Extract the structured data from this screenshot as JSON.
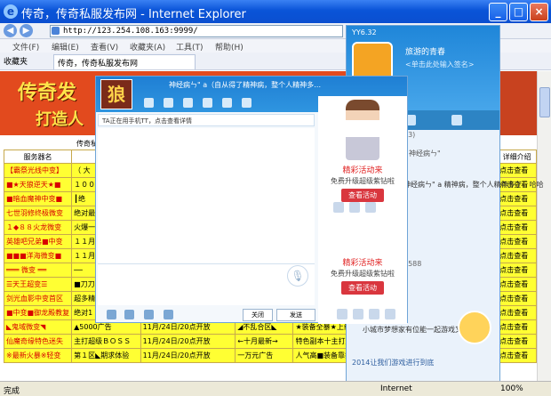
{
  "window": {
    "title": "传奇，传奇私服发布网 - Internet Explorer",
    "minimize": "_",
    "maximize": "□",
    "close": "×"
  },
  "address": {
    "url": "http://123.254.108.163:9999/"
  },
  "menu": [
    "文件(F)",
    "编辑(E)",
    "查看(V)",
    "收藏夹(A)",
    "工具(T)",
    "帮助(H)"
  ],
  "favorites": {
    "label": "收藏夹",
    "tab": "传奇，传奇私服发布网"
  },
  "banner": {
    "logo": "传奇发",
    "slogan": "打造人"
  },
  "list_title": "传奇私服",
  "table": {
    "headers": [
      "服务器名",
      "",
      "",
      "",
      "",
      "",
      "详细介绍"
    ],
    "rows": [
      [
        "【霸祭光线中变】",
        "（    大",
        "",
        "",
        "",
        "",
        "点击查看"
      ],
      [
        "■★天狼逆天★■",
        "１００",
        "",
        "",
        "",
        "",
        "点击查看"
      ],
      [
        "■暗血魔神中变■",
        "┃绝",
        "",
        "",
        "",
        "",
        "点击查看"
      ],
      [
        "七世羽修终极微变",
        "绝对最",
        "",
        "",
        "",
        "",
        "点击查看"
      ],
      [
        "１◆８８火龙微变",
        "火爆一",
        "",
        "",
        "",
        "",
        "点击查看"
      ],
      [
        "英雄吧兄弟■中变",
        "１１月",
        "",
        "",
        "",
        "",
        "点击查看"
      ],
      [
        "■■■洋海微变■",
        "１１月",
        "",
        "",
        "",
        "",
        "点击查看"
      ],
      [
        "═══ 微变 ══",
        "──",
        "",
        "",
        "",
        "",
        "点击查看"
      ],
      [
        "☰天王超变☰",
        "■刀刀",
        "",
        "",
        "",
        "",
        "点击查看"
      ],
      [
        "剑光血影中变首区",
        "超多精",
        "",
        "",
        "",
        "",
        "点击查看"
      ],
      [
        "■中变■御龙殿教复",
        "绝对1",
        "",
        "",
        "",
        "",
        "点击查看"
      ],
      [
        "◣鬼域微变◥",
        "▲5000广告",
        "11月/24日/20点开放",
        "◢不乱合区◣",
        "★装备全暴★上线就",
        "点击查看",
        "点击查看"
      ],
      [
        "仙魔奇缘特色迷失",
        "主打超级ＢＯＳＳ",
        "11月/24日/20点开放",
        "←十月最新→",
        "特色副本十主打超级",
        "点击查看",
        "点击查看"
      ],
      [
        "※最新火暴※轻变",
        "第１区◣期求体验",
        "11月/24日/20点开放",
        "一万元广告",
        "人气高■装备靠打■",
        "点击查看",
        "点击查看"
      ]
    ]
  },
  "qq": {
    "version": "YY6.32",
    "nick": "旅游的青春",
    "sign": "<单击此处输入签名>",
    "list_num": "23)",
    "mood": "神经病ㄣ\"  a 精神病，整个人精神多了，哈哈",
    "mood_name": "神经病ㄣ\"",
    "ssn": "7588",
    "invite": "小城市梦想家有位能一起游戏又省",
    "bottom": "2014让我们游戏进行到底"
  },
  "chat": {
    "name": "神经病ㄣ\"  a（自从得了精神病，整个人精神多…",
    "notice": "TA正在用手机TT，点击查看详情",
    "close_label": "关闭",
    "send_label": "发送",
    "ads": [
      {
        "title": "精彩活动来",
        "sub": "免费升级超级紫钻啦",
        "button": "查看活动"
      },
      {
        "title": "精彩活动来",
        "sub": "免费升级超级紫钻啦",
        "button": "查看活动"
      }
    ]
  },
  "status": {
    "text": "完成",
    "zone": "Internet",
    "zoom": "100%"
  },
  "colors": {
    "ie_title": "#0a54d8",
    "banner": "#e24a1e",
    "table_cell": "#ffff33",
    "qq_header": "#1f86d9",
    "ad_title": "#e02020"
  },
  "icons": [
    "ie-logo-icon",
    "back-icon",
    "forward-icon",
    "search-icon",
    "gear-icon",
    "mic-icon",
    "emoji-icon",
    "qq-avatar-icon"
  ]
}
